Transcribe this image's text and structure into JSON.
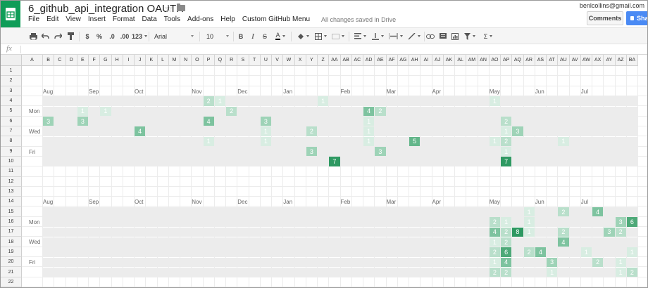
{
  "header": {
    "title": "6_github_api_integration OAUTH",
    "user": "benlcollins@gmail.com",
    "comments_label": "Comments",
    "share_label": "Share",
    "save_status": "All changes saved in Drive",
    "menus": [
      "File",
      "Edit",
      "View",
      "Insert",
      "Format",
      "Data",
      "Tools",
      "Add-ons",
      "Help",
      "Custom GitHub Menu"
    ]
  },
  "toolbar": {
    "currency": "$",
    "percent": "%",
    "decimal_less": ".0",
    "decimal_more": ".00",
    "format_more": "123",
    "font": "Arial",
    "font_size": "10",
    "bold": "B",
    "italic": "I",
    "strike": "S",
    "text_color": "A",
    "sum": "Σ"
  },
  "formula_bar": {
    "fx": "fx",
    "value": ""
  },
  "columns": [
    "A",
    "B",
    "C",
    "D",
    "E",
    "F",
    "G",
    "H",
    "I",
    "J",
    "K",
    "L",
    "M",
    "N",
    "O",
    "P",
    "Q",
    "R",
    "S",
    "T",
    "U",
    "V",
    "W",
    "X",
    "Y",
    "Z",
    "AA",
    "AB",
    "AC",
    "AD",
    "AE",
    "AF",
    "AG",
    "AH",
    "AI",
    "AJ",
    "AK",
    "AL",
    "AM",
    "AN",
    "AO",
    "AP",
    "AQ",
    "AR",
    "AS",
    "AT",
    "AU",
    "AV",
    "AW",
    "AX",
    "AY",
    "AZ",
    "BA"
  ],
  "rows": [
    "1",
    "2",
    "3",
    "4",
    "5",
    "6",
    "7",
    "8",
    "9",
    "10",
    "11",
    "12",
    "13",
    "14",
    "15",
    "16",
    "17",
    "18",
    "19",
    "20",
    "21",
    "22"
  ],
  "heatmaps": [
    {
      "months": [
        "Aug",
        "Sep",
        "Oct",
        "Nov",
        "Dec",
        "Jan",
        "Feb",
        "Mar",
        "Apr",
        "May",
        "Jun",
        "Jul"
      ],
      "days": [
        "Mon",
        "Wed",
        "Fri"
      ],
      "cells": [
        {
          "r": 4,
          "c": "P",
          "v": "2"
        },
        {
          "r": 4,
          "c": "Q",
          "v": "1"
        },
        {
          "r": 4,
          "c": "Z",
          "v": "1"
        },
        {
          "r": 4,
          "c": "AO",
          "v": "1"
        },
        {
          "r": 5,
          "c": "E",
          "v": "1"
        },
        {
          "r": 5,
          "c": "G",
          "v": "1"
        },
        {
          "r": 5,
          "c": "R",
          "v": "2"
        },
        {
          "r": 5,
          "c": "AD",
          "v": "4"
        },
        {
          "r": 5,
          "c": "AE",
          "v": "2"
        },
        {
          "r": 6,
          "c": "B",
          "v": "3"
        },
        {
          "r": 6,
          "c": "E",
          "v": "3"
        },
        {
          "r": 6,
          "c": "P",
          "v": "4"
        },
        {
          "r": 6,
          "c": "U",
          "v": "3"
        },
        {
          "r": 6,
          "c": "AD",
          "v": "1"
        },
        {
          "r": 6,
          "c": "AP",
          "v": "2"
        },
        {
          "r": 7,
          "c": "J",
          "v": "4"
        },
        {
          "r": 7,
          "c": "U",
          "v": "1"
        },
        {
          "r": 7,
          "c": "Y",
          "v": "2"
        },
        {
          "r": 7,
          "c": "AD",
          "v": "1"
        },
        {
          "r": 7,
          "c": "AP",
          "v": "1"
        },
        {
          "r": 7,
          "c": "AQ",
          "v": "3"
        },
        {
          "r": 8,
          "c": "P",
          "v": "1"
        },
        {
          "r": 8,
          "c": "U",
          "v": "1"
        },
        {
          "r": 8,
          "c": "AD",
          "v": "1"
        },
        {
          "r": 8,
          "c": "AH",
          "v": "5"
        },
        {
          "r": 8,
          "c": "AO",
          "v": "1"
        },
        {
          "r": 8,
          "c": "AP",
          "v": "2"
        },
        {
          "r": 8,
          "c": "AU",
          "v": "1"
        },
        {
          "r": 9,
          "c": "Y",
          "v": "3"
        },
        {
          "r": 9,
          "c": "AE",
          "v": "3"
        },
        {
          "r": 9,
          "c": "AP",
          "v": "1"
        },
        {
          "r": 10,
          "c": "AA",
          "v": "7"
        },
        {
          "r": 10,
          "c": "AP",
          "v": "7"
        }
      ]
    },
    {
      "months": [
        "Aug",
        "Sep",
        "Oct",
        "Nov",
        "Dec",
        "Jan",
        "Feb",
        "Mar",
        "Apr",
        "May",
        "Jun",
        "Jul"
      ],
      "days": [
        "Mon",
        "Wed",
        "Fri"
      ],
      "cells": [
        {
          "r": 15,
          "c": "AR",
          "v": "1"
        },
        {
          "r": 15,
          "c": "AU",
          "v": "2"
        },
        {
          "r": 15,
          "c": "AX",
          "v": "4"
        },
        {
          "r": 15,
          "c": "BB",
          "v": "1"
        },
        {
          "r": 16,
          "c": "AO",
          "v": "2"
        },
        {
          "r": 16,
          "c": "AP",
          "v": "1"
        },
        {
          "r": 16,
          "c": "AR",
          "v": "1"
        },
        {
          "r": 16,
          "c": "AZ",
          "v": "3"
        },
        {
          "r": 16,
          "c": "BA",
          "v": "6"
        },
        {
          "r": 17,
          "c": "AO",
          "v": "4"
        },
        {
          "r": 17,
          "c": "AP",
          "v": "2"
        },
        {
          "r": 17,
          "c": "AQ",
          "v": "8"
        },
        {
          "r": 17,
          "c": "AR",
          "v": "1"
        },
        {
          "r": 17,
          "c": "AU",
          "v": "2"
        },
        {
          "r": 17,
          "c": "AY",
          "v": "3"
        },
        {
          "r": 17,
          "c": "AZ",
          "v": "2"
        },
        {
          "r": 18,
          "c": "AO",
          "v": "1"
        },
        {
          "r": 18,
          "c": "AP",
          "v": "2"
        },
        {
          "r": 18,
          "c": "AU",
          "v": "4"
        },
        {
          "r": 18,
          "c": "BB",
          "v": "5"
        },
        {
          "r": 19,
          "c": "AO",
          "v": "2"
        },
        {
          "r": 19,
          "c": "AP",
          "v": "6"
        },
        {
          "r": 19,
          "c": "AR",
          "v": "2"
        },
        {
          "r": 19,
          "c": "AS",
          "v": "4"
        },
        {
          "r": 19,
          "c": "AW",
          "v": "1"
        },
        {
          "r": 19,
          "c": "BA",
          "v": "1"
        },
        {
          "r": 20,
          "c": "AO",
          "v": "1"
        },
        {
          "r": 20,
          "c": "AP",
          "v": "4"
        },
        {
          "r": 20,
          "c": "AT",
          "v": "3"
        },
        {
          "r": 20,
          "c": "AX",
          "v": "2"
        },
        {
          "r": 20,
          "c": "AZ",
          "v": "1"
        },
        {
          "r": 21,
          "c": "AO",
          "v": "2"
        },
        {
          "r": 21,
          "c": "AP",
          "v": "2"
        },
        {
          "r": 21,
          "c": "AT",
          "v": "1"
        },
        {
          "r": 21,
          "c": "AZ",
          "v": "1"
        },
        {
          "r": 21,
          "c": "BA",
          "v": "2"
        }
      ]
    }
  ],
  "colors": {
    "brand": "#0f9d58",
    "share": "#4a8af4",
    "heat_empty": "#ececec"
  }
}
